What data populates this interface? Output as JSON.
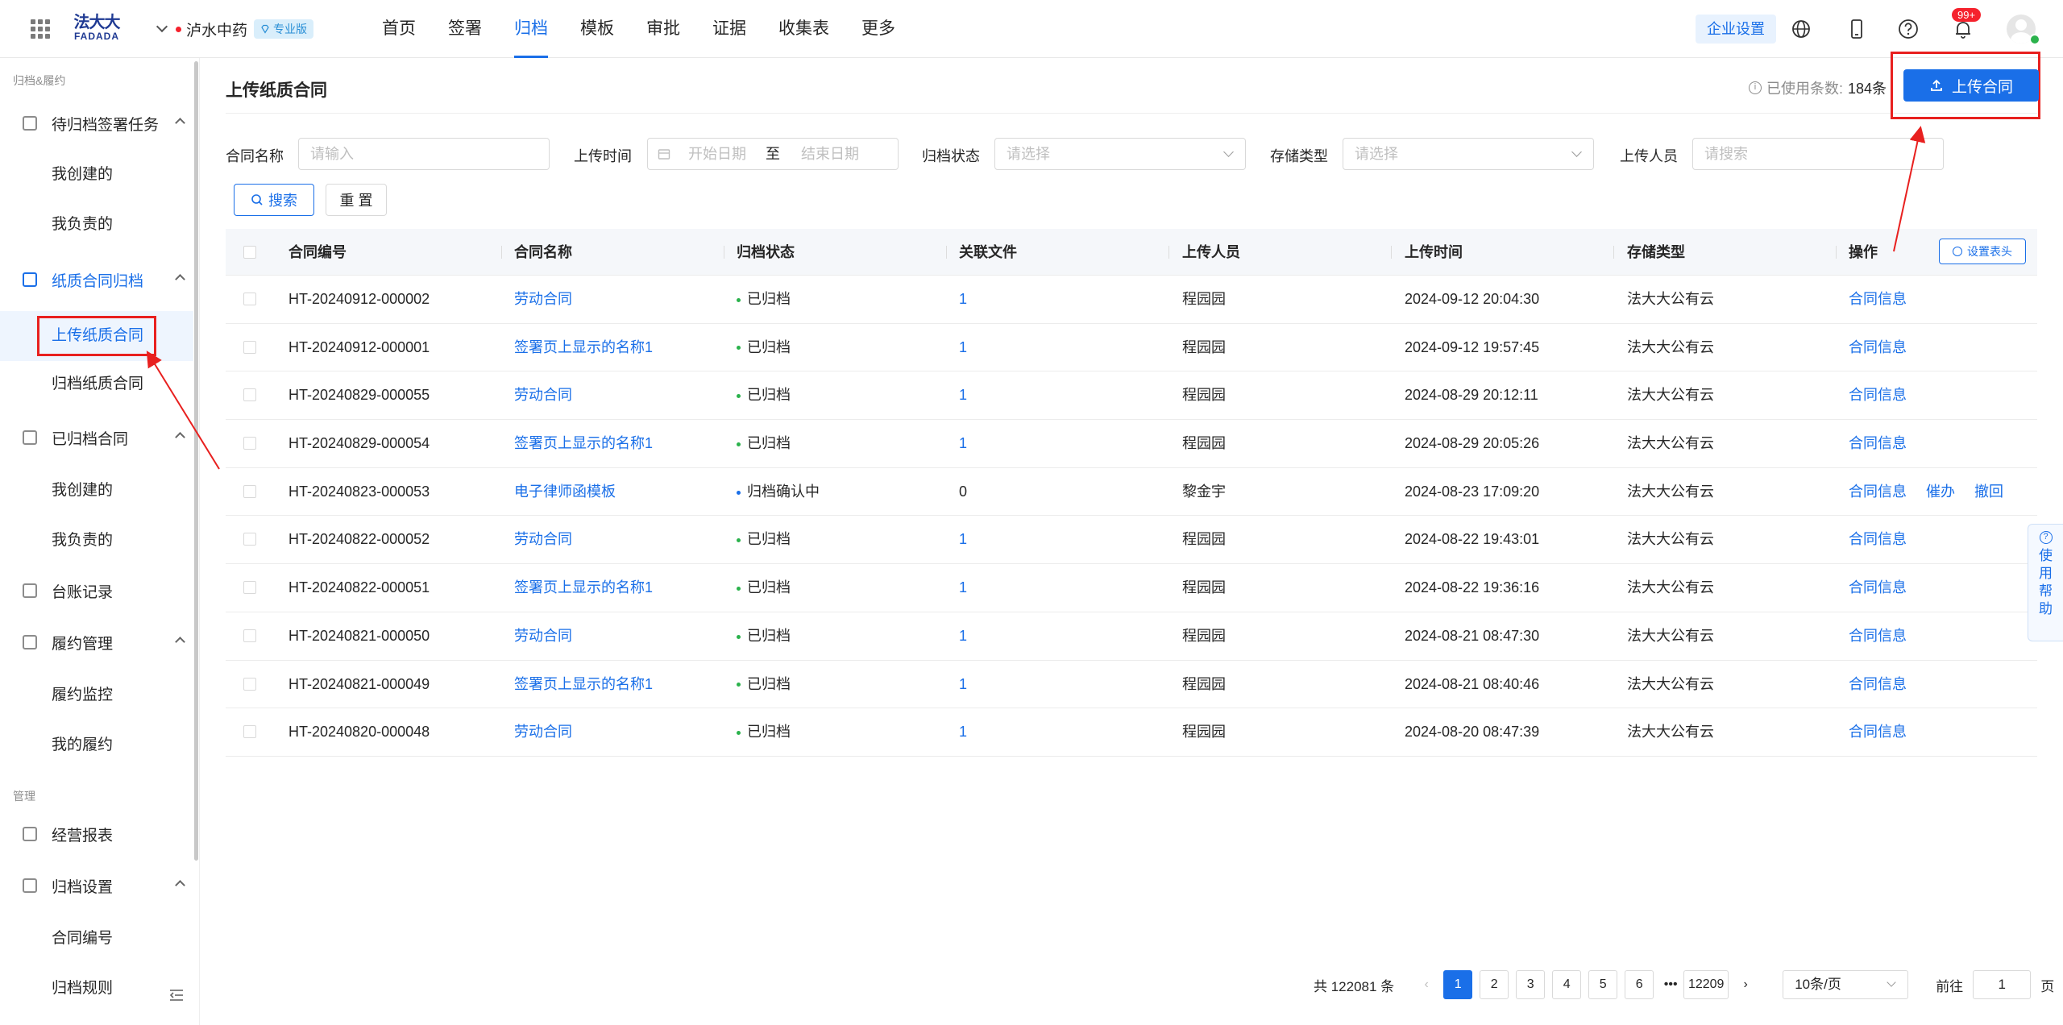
{
  "header": {
    "logo_cn": "法大大",
    "logo_en": "FADADA",
    "company_name": "泸水中药",
    "edition_badge": "专业版",
    "nav": [
      "首页",
      "签署",
      "归档",
      "模板",
      "审批",
      "证据",
      "收集表",
      "更多"
    ],
    "active_nav": "归档",
    "enterprise_settings": "企业设置",
    "notification_count": "99+",
    "icons": [
      "apps-grid-icon",
      "globe-icon",
      "mobile-icon",
      "help-icon",
      "bell-icon",
      "avatar"
    ]
  },
  "sidebar": {
    "section1": "归档&履约",
    "groups": {
      "pending": "待归档签署任务",
      "pending_created": "我创建的",
      "pending_responsible": "我负责的",
      "paper": "纸质合同归档",
      "paper_upload": "上传纸质合同",
      "paper_archive": "归档纸质合同",
      "archived": "已归档合同",
      "archived_created": "我创建的",
      "archived_responsible": "我负责的",
      "ledger": "台账记录",
      "performance": "履约管理",
      "performance_monitor": "履约监控",
      "performance_mine": "我的履约"
    },
    "section2": "管理",
    "mgmt": {
      "report": "经营报表",
      "settings": "归档设置",
      "contract_no": "合同编号",
      "rules": "归档规则"
    }
  },
  "main": {
    "title": "上传纸质合同",
    "usage_label": "已使用条数:",
    "usage_value": "184条",
    "upload_button": "上传合同",
    "filters": {
      "contract_name_label": "合同名称",
      "contract_name_placeholder": "请输入",
      "upload_time_label": "上传时间",
      "start_date_placeholder": "开始日期",
      "date_sep": "至",
      "end_date_placeholder": "结束日期",
      "archive_status_label": "归档状态",
      "archive_status_placeholder": "请选择",
      "storage_type_label": "存储类型",
      "storage_type_placeholder": "请选择",
      "uploader_label": "上传人员",
      "uploader_placeholder": "请搜索",
      "search_button": "搜索",
      "reset_button": "重 置"
    },
    "table": {
      "columns": [
        "合同编号",
        "合同名称",
        "归档状态",
        "关联文件",
        "上传人员",
        "上传时间",
        "存储类型",
        "操作"
      ],
      "column_settings": "设置表头",
      "rows": [
        {
          "id": "HT-20240912-000002",
          "name": "劳动合同",
          "status": "已归档",
          "status_color": "#2bb24c",
          "files": "1",
          "uploader": "程园园",
          "time": "2024-09-12 20:04:30",
          "storage": "法大大公有云",
          "actions": [
            "合同信息"
          ]
        },
        {
          "id": "HT-20240912-000001",
          "name": "签署页上显示的名称1",
          "status": "已归档",
          "status_color": "#2bb24c",
          "files": "1",
          "uploader": "程园园",
          "time": "2024-09-12 19:57:45",
          "storage": "法大大公有云",
          "actions": [
            "合同信息"
          ]
        },
        {
          "id": "HT-20240829-000055",
          "name": "劳动合同",
          "status": "已归档",
          "status_color": "#2bb24c",
          "files": "1",
          "uploader": "程园园",
          "time": "2024-08-29 20:12:11",
          "storage": "法大大公有云",
          "actions": [
            "合同信息"
          ]
        },
        {
          "id": "HT-20240829-000054",
          "name": "签署页上显示的名称1",
          "status": "已归档",
          "status_color": "#2bb24c",
          "files": "1",
          "uploader": "程园园",
          "time": "2024-08-29 20:05:26",
          "storage": "法大大公有云",
          "actions": [
            "合同信息"
          ]
        },
        {
          "id": "HT-20240823-000053",
          "name": "电子律师函模板",
          "status": "归档确认中",
          "status_color": "#1a6fe8",
          "files": "0",
          "uploader": "黎金宇",
          "time": "2024-08-23 17:09:20",
          "storage": "法大大公有云",
          "actions": [
            "合同信息",
            "催办",
            "撤回"
          ]
        },
        {
          "id": "HT-20240822-000052",
          "name": "劳动合同",
          "status": "已归档",
          "status_color": "#2bb24c",
          "files": "1",
          "uploader": "程园园",
          "time": "2024-08-22 19:43:01",
          "storage": "法大大公有云",
          "actions": [
            "合同信息"
          ]
        },
        {
          "id": "HT-20240822-000051",
          "name": "签署页上显示的名称1",
          "status": "已归档",
          "status_color": "#2bb24c",
          "files": "1",
          "uploader": "程园园",
          "time": "2024-08-22 19:36:16",
          "storage": "法大大公有云",
          "actions": [
            "合同信息"
          ]
        },
        {
          "id": "HT-20240821-000050",
          "name": "劳动合同",
          "status": "已归档",
          "status_color": "#2bb24c",
          "files": "1",
          "uploader": "程园园",
          "time": "2024-08-21 08:47:30",
          "storage": "法大大公有云",
          "actions": [
            "合同信息"
          ]
        },
        {
          "id": "HT-20240821-000049",
          "name": "签署页上显示的名称1",
          "status": "已归档",
          "status_color": "#2bb24c",
          "files": "1",
          "uploader": "程园园",
          "time": "2024-08-21 08:40:46",
          "storage": "法大大公有云",
          "actions": [
            "合同信息"
          ]
        },
        {
          "id": "HT-20240820-000048",
          "name": "劳动合同",
          "status": "已归档",
          "status_color": "#2bb24c",
          "files": "1",
          "uploader": "程园园",
          "time": "2024-08-20 08:47:39",
          "storage": "法大大公有云",
          "actions": [
            "合同信息"
          ]
        }
      ]
    },
    "pagination": {
      "total": "共 122081 条",
      "pages": [
        "1",
        "2",
        "3",
        "4",
        "5",
        "6"
      ],
      "ellipsis": "•••",
      "last_page": "12209",
      "current": "1",
      "page_size": "10条/页",
      "goto_label": "前往",
      "goto_value": "1",
      "goto_suffix": "页"
    },
    "help_tab": "使用帮助"
  },
  "colors": {
    "primary": "#1a6fe8",
    "annotation_red": "#e8201f",
    "archived_green": "#2bb24c"
  }
}
